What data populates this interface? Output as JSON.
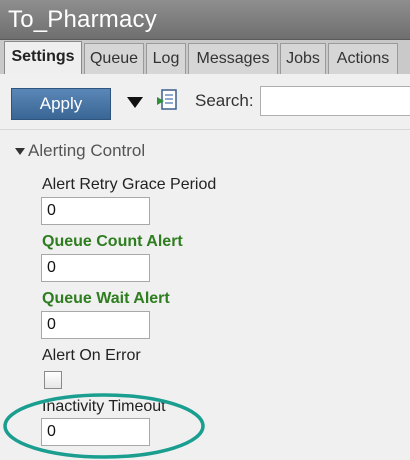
{
  "window": {
    "title": "To_Pharmacy"
  },
  "tabs": [
    {
      "label": "Settings",
      "active": true
    },
    {
      "label": "Queue",
      "active": false
    },
    {
      "label": "Log",
      "active": false
    },
    {
      "label": "Messages",
      "active": false
    },
    {
      "label": "Jobs",
      "active": false
    },
    {
      "label": "Actions",
      "active": false
    }
  ],
  "toolbar": {
    "apply_label": "Apply",
    "dropdown_icon": "triangle-down-icon",
    "export_icon": "export-document-icon",
    "search_label": "Search:",
    "search_value": ""
  },
  "section": {
    "title": "Alerting Control",
    "expanded": true
  },
  "fields": {
    "alert_retry": {
      "label": "Alert Retry Grace Period",
      "value": "0"
    },
    "queue_count": {
      "label": "Queue Count Alert",
      "value": "0"
    },
    "queue_wait": {
      "label": "Queue Wait Alert",
      "value": "0"
    },
    "alert_on_error": {
      "label": "Alert On Error",
      "checked": false
    },
    "inactivity": {
      "label": "Inactivity Timeout",
      "value": "0"
    }
  },
  "colors": {
    "apply_button": "#3f6b9c",
    "highlight_label": "#2e7d1f",
    "annotation_ellipse": "#1a9e8f"
  }
}
